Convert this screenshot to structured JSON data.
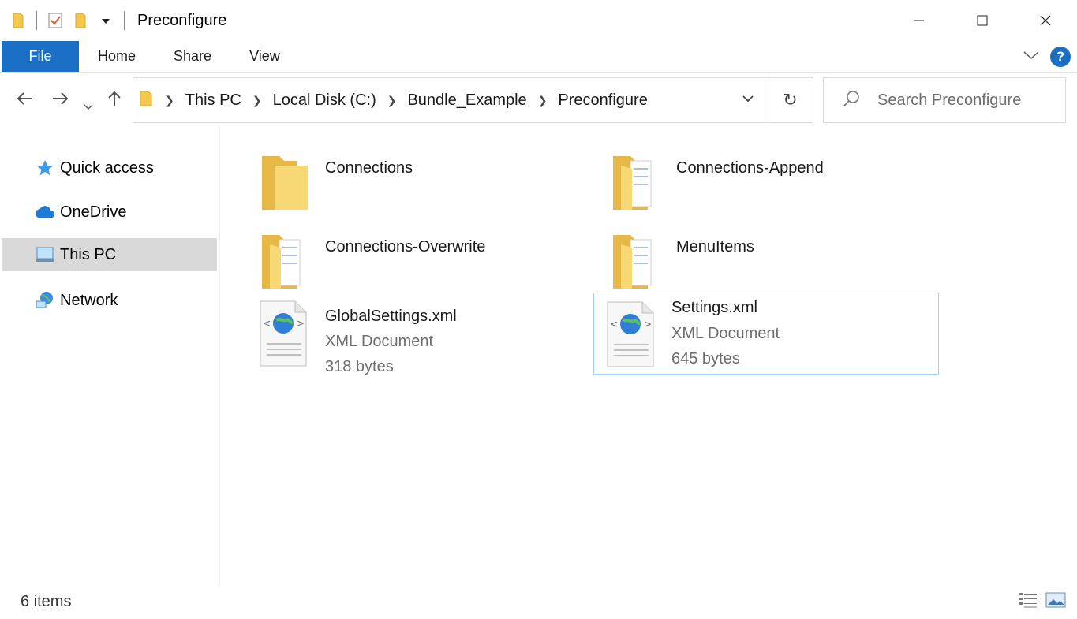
{
  "window": {
    "title": "Preconfigure"
  },
  "ribbon": {
    "file_label": "File",
    "tabs": [
      {
        "label": "Home"
      },
      {
        "label": "Share"
      },
      {
        "label": "View"
      }
    ],
    "help_label": "?"
  },
  "address_bar": {
    "crumbs": [
      "This PC",
      "Local Disk (C:)",
      "Bundle_Example",
      "Preconfigure"
    ]
  },
  "search": {
    "placeholder": "Search Preconfigure"
  },
  "sidebar": {
    "items": [
      {
        "label": "Quick access",
        "icon": "star-icon"
      },
      {
        "label": "OneDrive",
        "icon": "cloud-icon"
      },
      {
        "label": "This PC",
        "icon": "computer-icon",
        "selected": true
      },
      {
        "label": "Network",
        "icon": "network-icon"
      }
    ]
  },
  "files": [
    {
      "name": "Connections",
      "kind": "folder"
    },
    {
      "name": "Connections-Append",
      "kind": "folder-docs"
    },
    {
      "name": "Connections-Overwrite",
      "kind": "folder-docs"
    },
    {
      "name": "MenuItems",
      "kind": "folder-docs"
    },
    {
      "name": "GlobalSettings.xml",
      "type": "XML Document",
      "size": "318 bytes",
      "kind": "xml"
    },
    {
      "name": "Settings.xml",
      "type": "XML Document",
      "size": "645 bytes",
      "kind": "xml",
      "selected": true
    }
  ],
  "status": {
    "item_count": "6 items"
  },
  "colors": {
    "accent": "#1a6fc4",
    "selection_border": "#99d1ff",
    "sidebar_selected": "#d9d9d9",
    "folder_yellow": "#f8d775"
  }
}
